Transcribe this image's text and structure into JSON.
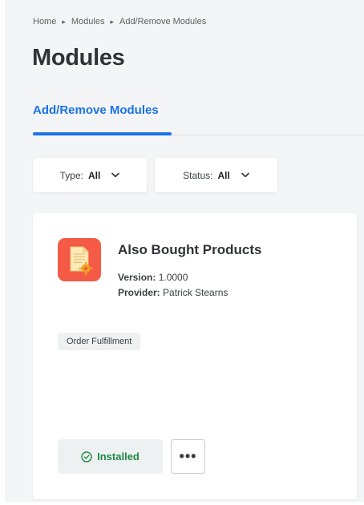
{
  "breadcrumb": {
    "items": [
      "Home",
      "Modules",
      "Add/Remove Modules"
    ]
  },
  "page": {
    "title": "Modules"
  },
  "tabs": [
    {
      "label": "Add/Remove Modules",
      "active": true
    }
  ],
  "filters": {
    "type": {
      "label": "Type:",
      "value": "All"
    },
    "status": {
      "label": "Status:",
      "value": "All"
    }
  },
  "module": {
    "name": "Also Bought Products",
    "version_label": "Version:",
    "version": "1.0000",
    "provider_label": "Provider:",
    "provider": "Patrick Stearns",
    "tag": "Order Fulfillment",
    "icon": "document-gear-icon",
    "status_label": "Installed",
    "more_label": "•••"
  },
  "colors": {
    "accent": "#1a73e8",
    "installed_text": "#1e8a45",
    "icon_bg": "#f55a46"
  }
}
